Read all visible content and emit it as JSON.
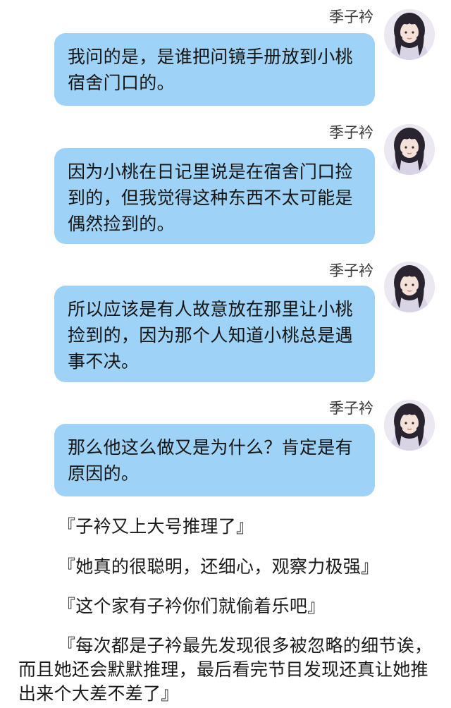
{
  "messages": [
    {
      "sender": "季子衿",
      "text": "我问的是，是谁把问镜手册放到小桃宿舍门口的。"
    },
    {
      "sender": "季子衿",
      "text": "因为小桃在日记里说是在宿舍门口捡到的，但我觉得这种东西不太可能是偶然捡到的。"
    },
    {
      "sender": "季子衿",
      "text": "所以应该是有人故意放在那里让小桃捡到的，因为那个人知道小桃总是遇事不决。"
    },
    {
      "sender": "季子衿",
      "text": "那么他这么做又是为什么？肯定是有原因的。"
    }
  ],
  "comments": [
    "『子衿又上大号推理了』",
    "『她真的很聪明，还细心，观察力极强』",
    "『这个家有子衿你们就偷着乐吧』",
    "『每次都是子衿最先发现很多被忽略的细节诶，而且她还会默默推理，最后看完节目发现还真让她推出来个大差不差了』"
  ],
  "colors": {
    "bubble": "#9ed2f6",
    "background": "#ffffff",
    "text": "#1a1a1a"
  },
  "icons": {
    "avatar": "user-avatar-photo"
  }
}
